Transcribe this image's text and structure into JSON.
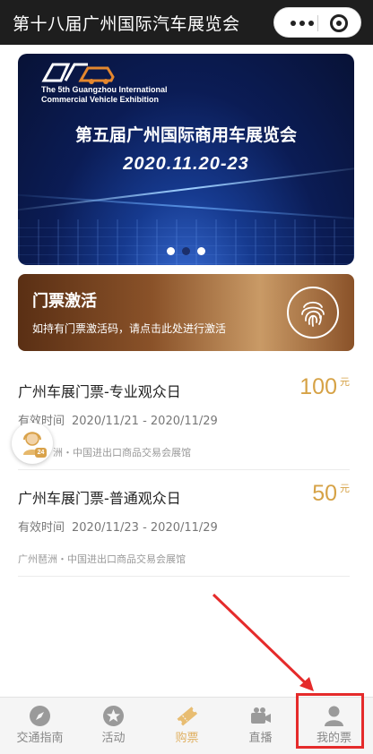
{
  "header": {
    "title": "第十八届广州国际汽车展览会"
  },
  "banner": {
    "en_line1": "The 5th Guangzhou International",
    "en_line2": "Commercial Vehicle Exhibition",
    "title_cn": "第五届广州国际商用车展览会",
    "date": "2020.11.20-23",
    "slides_total": 3,
    "active_slide": 1
  },
  "activation": {
    "title": "门票激活",
    "desc": "如持有门票激活码，请点击此处进行激活"
  },
  "tickets": [
    {
      "title": "广州车展门票-专业观众日",
      "price": "100",
      "unit": "元",
      "valid_label": "有效时间",
      "valid_range": "2020/11/21 - 2020/11/29",
      "location": "洲・中国进出口商品交易会展馆"
    },
    {
      "title": "广州车展门票-普通观众日",
      "price": "50",
      "unit": "元",
      "valid_label": "有效时间",
      "valid_range": "2020/11/23 - 2020/11/29",
      "location": "广州琶洲・中国进出口商品交易会展馆"
    }
  ],
  "service_badge": "24",
  "tabbar": {
    "items": [
      {
        "label": "交通指南",
        "icon": "compass-icon"
      },
      {
        "label": "活动",
        "icon": "star-icon"
      },
      {
        "label": "购票",
        "icon": "ticket-icon"
      },
      {
        "label": "直播",
        "icon": "video-icon"
      },
      {
        "label": "我的票",
        "icon": "person-icon"
      }
    ],
    "active": "购票"
  },
  "colors": {
    "header_bg": "#1e1e1e",
    "price": "#d6a246",
    "active_tab": "#e0b163",
    "annotation_red": "#e52b2b"
  }
}
